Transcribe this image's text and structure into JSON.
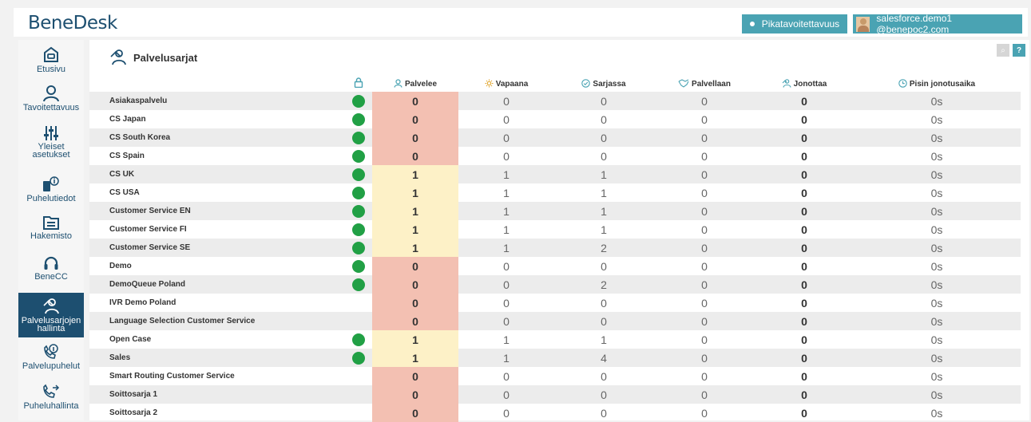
{
  "app": {
    "logo": "BeneDesk",
    "availability_label": "Pikatavoitettavuus",
    "user_email": "salesforce.demo1 @benepoc2.com"
  },
  "sidebar": {
    "items": [
      {
        "label": "Etusivu",
        "icon": "home-icon"
      },
      {
        "label": "Tavoitettavuus",
        "icon": "person-icon"
      },
      {
        "label": "Yleiset asetukset",
        "icon": "sliders-icon"
      },
      {
        "label": "Puhelutiedot",
        "icon": "phone-info-icon"
      },
      {
        "label": "Hakemisto",
        "icon": "folder-icon"
      },
      {
        "label": "BeneCC",
        "icon": "headset-icon"
      },
      {
        "label": "Palvelusarjojen hallinta",
        "icon": "queue-management-icon",
        "active": true
      },
      {
        "label": "Palvelupuhelut",
        "icon": "service-call-icon"
      },
      {
        "label": "Puheluhallinta",
        "icon": "call-transfer-icon"
      }
    ]
  },
  "page": {
    "title": "Palvelusarjat"
  },
  "table": {
    "headers": {
      "palvelee": "Palvelee",
      "vapaana": "Vapaana",
      "sarjassa": "Sarjassa",
      "palvellaan": "Palvellaan",
      "jonottaa": "Jonottaa",
      "pisin": "Pisin jonotusaika"
    },
    "rows": [
      {
        "name": "Asiakaspalvelu",
        "open": true,
        "palvelee": "0",
        "vapaana": "0",
        "sarjassa": "0",
        "palvellaan": "0",
        "jonottaa": "0",
        "pisin": "0s"
      },
      {
        "name": "CS Japan",
        "open": true,
        "palvelee": "0",
        "vapaana": "0",
        "sarjassa": "0",
        "palvellaan": "0",
        "jonottaa": "0",
        "pisin": "0s"
      },
      {
        "name": "CS South Korea",
        "open": true,
        "palvelee": "0",
        "vapaana": "0",
        "sarjassa": "0",
        "palvellaan": "0",
        "jonottaa": "0",
        "pisin": "0s"
      },
      {
        "name": "CS Spain",
        "open": true,
        "palvelee": "0",
        "vapaana": "0",
        "sarjassa": "0",
        "palvellaan": "0",
        "jonottaa": "0",
        "pisin": "0s"
      },
      {
        "name": "CS UK",
        "open": true,
        "palvelee": "1",
        "vapaana": "1",
        "sarjassa": "1",
        "palvellaan": "0",
        "jonottaa": "0",
        "pisin": "0s"
      },
      {
        "name": "CS USA",
        "open": true,
        "palvelee": "1",
        "vapaana": "1",
        "sarjassa": "1",
        "palvellaan": "0",
        "jonottaa": "0",
        "pisin": "0s"
      },
      {
        "name": "Customer Service EN",
        "open": true,
        "palvelee": "1",
        "vapaana": "1",
        "sarjassa": "1",
        "palvellaan": "0",
        "jonottaa": "0",
        "pisin": "0s"
      },
      {
        "name": "Customer Service FI",
        "open": true,
        "palvelee": "1",
        "vapaana": "1",
        "sarjassa": "1",
        "palvellaan": "0",
        "jonottaa": "0",
        "pisin": "0s"
      },
      {
        "name": "Customer Service SE",
        "open": true,
        "palvelee": "1",
        "vapaana": "1",
        "sarjassa": "2",
        "palvellaan": "0",
        "jonottaa": "0",
        "pisin": "0s"
      },
      {
        "name": "Demo",
        "open": true,
        "palvelee": "0",
        "vapaana": "0",
        "sarjassa": "0",
        "palvellaan": "0",
        "jonottaa": "0",
        "pisin": "0s"
      },
      {
        "name": "DemoQueue Poland",
        "open": true,
        "palvelee": "0",
        "vapaana": "0",
        "sarjassa": "2",
        "palvellaan": "0",
        "jonottaa": "0",
        "pisin": "0s"
      },
      {
        "name": "IVR Demo Poland",
        "open": false,
        "palvelee": "0",
        "vapaana": "0",
        "sarjassa": "0",
        "palvellaan": "0",
        "jonottaa": "0",
        "pisin": "0s"
      },
      {
        "name": "Language Selection Customer Service",
        "open": false,
        "palvelee": "0",
        "vapaana": "0",
        "sarjassa": "0",
        "palvellaan": "0",
        "jonottaa": "0",
        "pisin": "0s"
      },
      {
        "name": "Open Case",
        "open": true,
        "palvelee": "1",
        "vapaana": "1",
        "sarjassa": "1",
        "palvellaan": "0",
        "jonottaa": "0",
        "pisin": "0s"
      },
      {
        "name": "Sales",
        "open": true,
        "palvelee": "1",
        "vapaana": "1",
        "sarjassa": "4",
        "palvellaan": "0",
        "jonottaa": "0",
        "pisin": "0s"
      },
      {
        "name": "Smart Routing Customer Service",
        "open": false,
        "palvelee": "0",
        "vapaana": "0",
        "sarjassa": "0",
        "palvellaan": "0",
        "jonottaa": "0",
        "pisin": "0s"
      },
      {
        "name": "Soittosarja 1",
        "open": false,
        "palvelee": "0",
        "vapaana": "0",
        "sarjassa": "0",
        "palvellaan": "0",
        "jonottaa": "0",
        "pisin": "0s"
      },
      {
        "name": "Soittosarja 2",
        "open": false,
        "palvelee": "0",
        "vapaana": "0",
        "sarjassa": "0",
        "palvellaan": "0",
        "jonottaa": "0",
        "pisin": "0s"
      }
    ]
  },
  "colors": {
    "brand": "#1d4f70",
    "accent": "#4aa3b3",
    "open_status": "#21a045",
    "serving_zero": "#f3c0b2",
    "serving_one": "#fdf1c7"
  }
}
